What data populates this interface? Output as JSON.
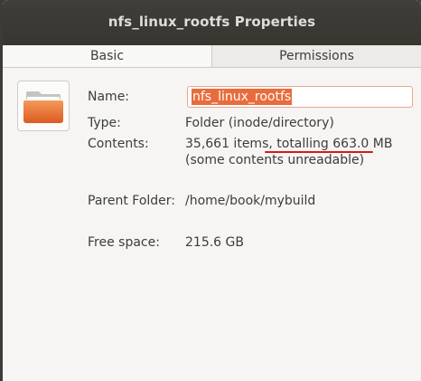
{
  "window": {
    "title": "nfs_linux_rootfs Properties"
  },
  "tabs": [
    {
      "label": "Basic"
    },
    {
      "label": "Permissions"
    }
  ],
  "basic": {
    "name_label": "Name:",
    "name_value": "nfs_linux_rootfs",
    "type_label": "Type:",
    "type_value": "Folder (inode/directory)",
    "contents_label": "Contents:",
    "contents_value": "35,661 items, totalling 663.0 MB",
    "contents_note": "(some contents unreadable)",
    "parent_label": "Parent Folder:",
    "parent_value": "/home/book/mybuild",
    "free_label": "Free space:",
    "free_value": "215.6 GB"
  },
  "icons": {
    "folder": "folder-icon"
  },
  "colors": {
    "folder_orange": "#e3622a",
    "selection": "#e96c3c",
    "annotation": "#d11b1b"
  }
}
